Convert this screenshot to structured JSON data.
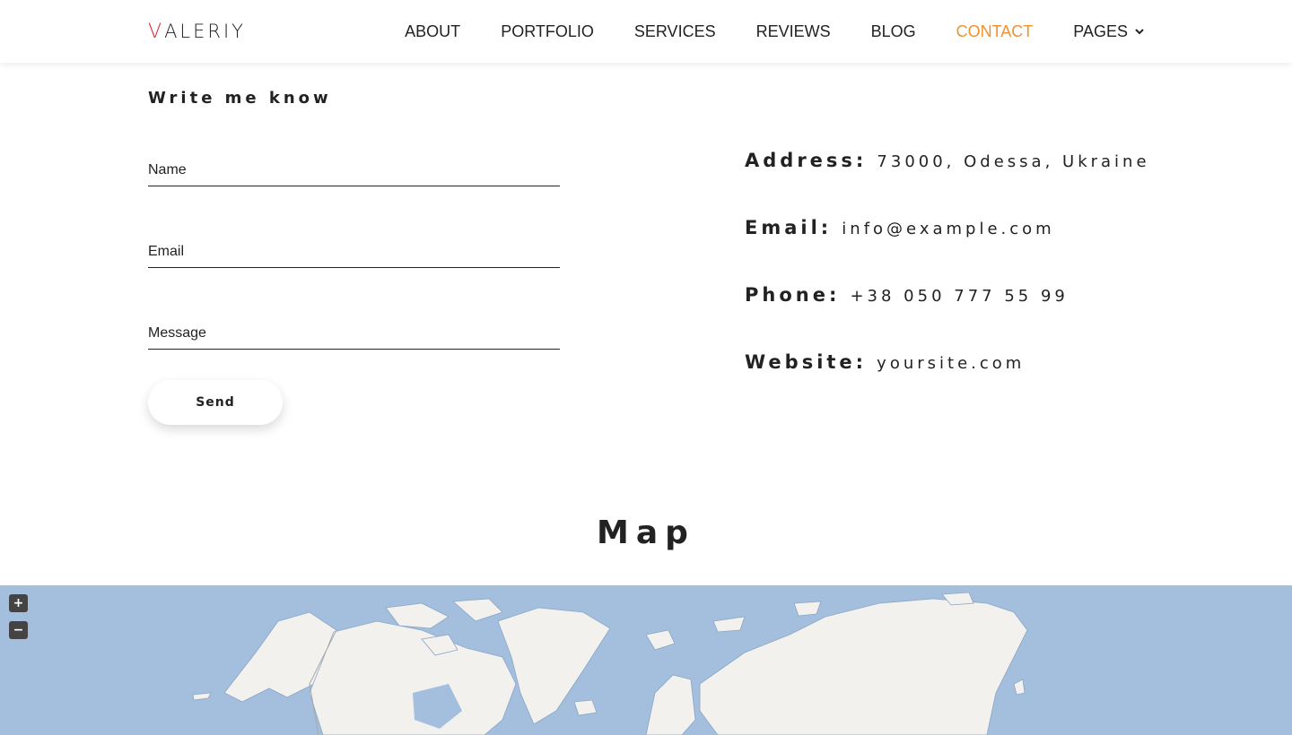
{
  "logo": {
    "first_letter": "V",
    "rest": "ALERIY"
  },
  "nav": {
    "items": [
      {
        "label": "ABOUT"
      },
      {
        "label": "PORTFOLIO"
      },
      {
        "label": "SERVICES"
      },
      {
        "label": "REVIEWS"
      },
      {
        "label": "BLOG"
      },
      {
        "label": "CONTACT"
      },
      {
        "label": "PAGES"
      }
    ],
    "active": "CONTACT",
    "active_color": "#f0922c"
  },
  "form": {
    "title": "Write me know",
    "name_placeholder": "Name",
    "email_placeholder": "Email",
    "message_placeholder": "Message",
    "send_label": "Send"
  },
  "contact": {
    "address_label": "Address:",
    "address_value": "73000, Odessa, Ukraine",
    "email_label": "Email:",
    "email_value": "info@example.com",
    "phone_label": "Phone:",
    "phone_value": "+38 050 777 55 99",
    "website_label": "Website:",
    "website_value": "yoursite.com"
  },
  "map": {
    "title": "Map",
    "zoom_in": "+",
    "zoom_out": "−",
    "water_color": "#a3bfdd",
    "land_color": "#f2f1ee"
  }
}
